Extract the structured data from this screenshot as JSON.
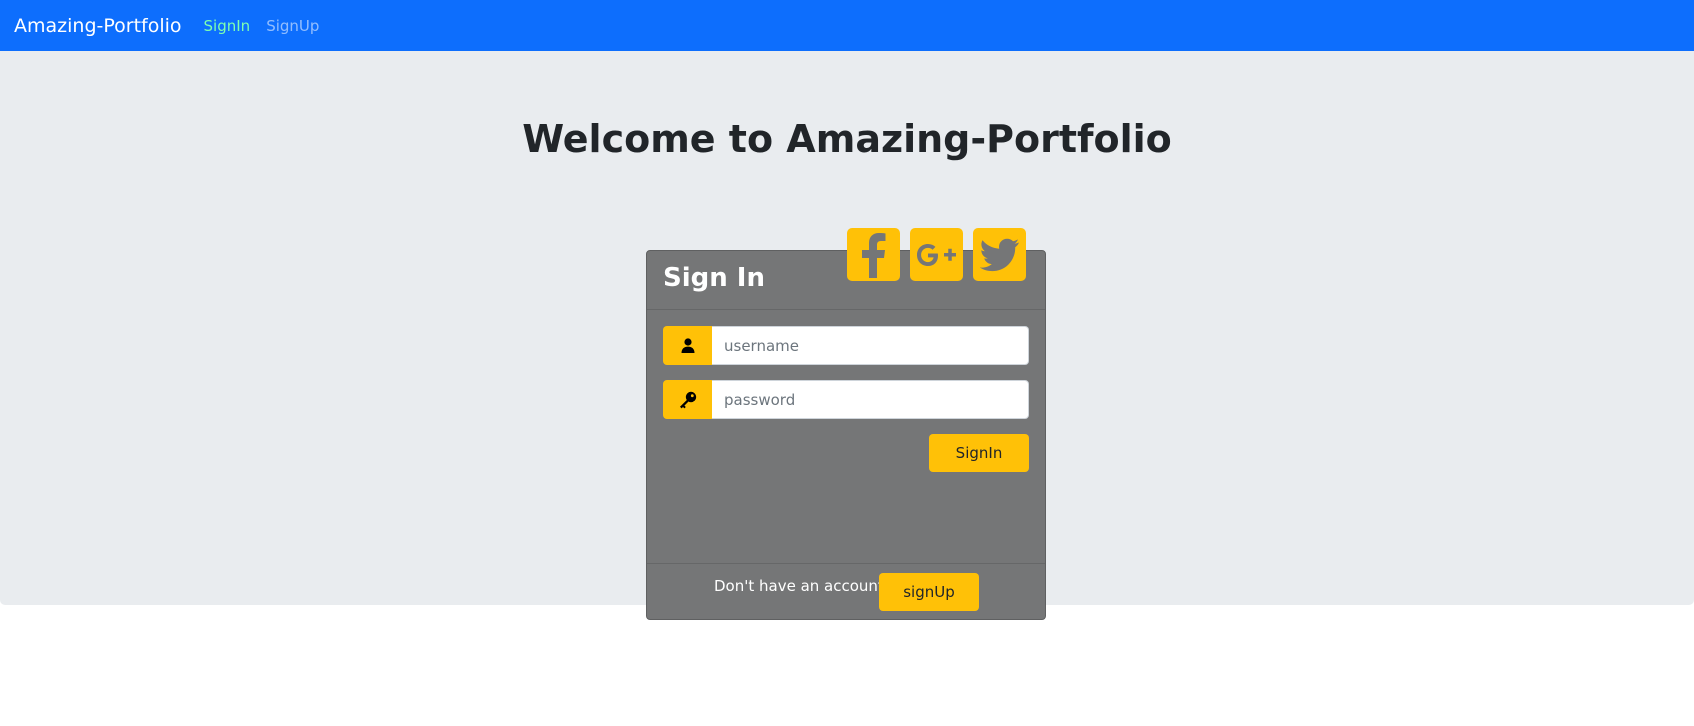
{
  "navbar": {
    "brand": "Amazing-Portfolio",
    "links": [
      {
        "label": "SignIn",
        "active": true
      },
      {
        "label": "SignUp",
        "active": false
      }
    ]
  },
  "main": {
    "heading": "Welcome to Amazing-Portfolio"
  },
  "signin_card": {
    "title": "Sign In",
    "social_icons": [
      "facebook-icon",
      "google-plus-icon",
      "twitter-icon"
    ],
    "username": {
      "placeholder": "username",
      "value": "",
      "icon": "user-icon"
    },
    "password": {
      "placeholder": "password",
      "value": "",
      "icon": "key-icon"
    },
    "submit_label": "SignIn",
    "footer_text": "Don't have an account?",
    "signup_label": "signUp"
  },
  "colors": {
    "navbar": "#0d6efd",
    "accent": "#ffc107",
    "card": "#757677",
    "jumbotron": "#e9ecef"
  }
}
